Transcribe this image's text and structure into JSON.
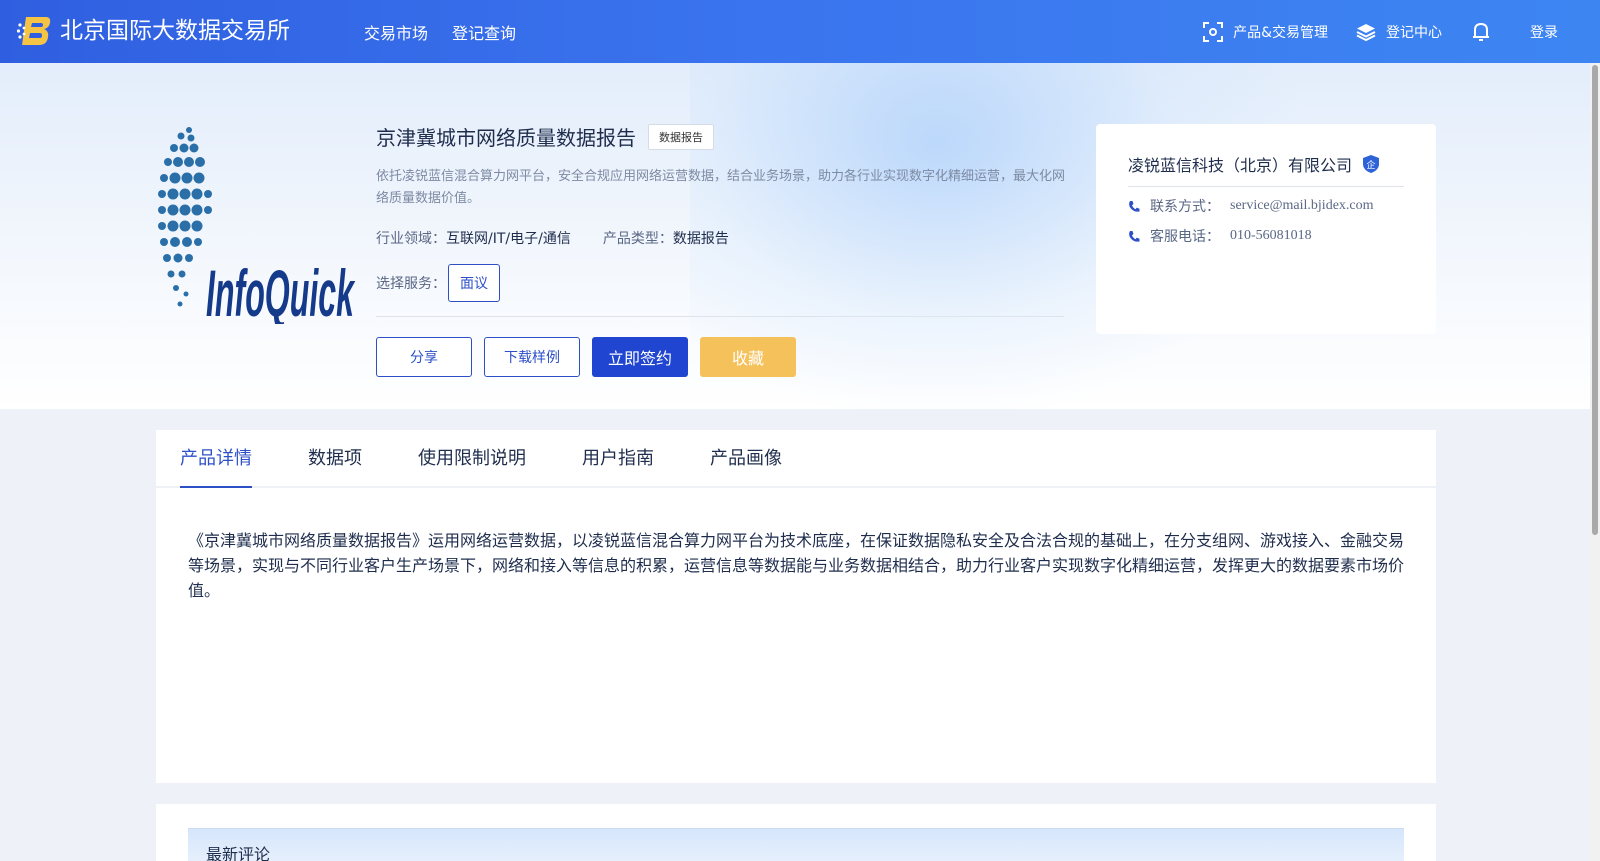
{
  "header": {
    "brand_name": "北京国际大数据交易所",
    "nav": [
      "交易市场",
      "登记查询"
    ],
    "product_mgmt": "产品&交易管理",
    "registry_center": "登记中心",
    "login": "登录"
  },
  "product": {
    "logo_text": "InfoQuick",
    "title": "京津冀城市网络质量数据报告",
    "tag": "数据报告",
    "description": "依托凌锐蓝信混合算力网平台，安全合规应用网络运营数据，结合业务场景，助力各行业实现数字化精细运营，最大化网络质量数据价值。",
    "industry_label": "行业领域：",
    "industry_value": "互联网/IT/电子/通信",
    "type_label": "产品类型：",
    "type_value": "数据报告",
    "service_label": "选择服务：",
    "service_option": "面议",
    "buttons": {
      "share": "分享",
      "download_sample": "下载样例",
      "sign_now": "立即签约",
      "favorite": "收藏"
    }
  },
  "company": {
    "name": "凌锐蓝信科技（北京）有限公司",
    "badge": "企",
    "contact_label": "联系方式：",
    "contact_value": "service@mail.bjidex.com",
    "phone_label": "客服电话：",
    "phone_value": "010-56081018"
  },
  "tabs": [
    "产品详情",
    "数据项",
    "使用限制说明",
    "用户指南",
    "产品画像"
  ],
  "active_tab": 0,
  "detail_text": "《京津冀城市网络质量数据报告》运用网络运营数据，以凌锐蓝信混合算力网平台为技术底座，在保证数据隐私安全及合法合规的基础上，在分支组网、游戏接入、金融交易等场景，实现与不同行业客户生产场景下，网络和接入等信息的积累，运营信息等数据能与业务数据相结合，助力行业客户实现数字化精细运营，发挥更大的数据要素市场价值。",
  "comments": {
    "title": "最新评论"
  },
  "colors": {
    "primary": "#1f45d1",
    "accent_gold": "#f4c15a",
    "header_gradient_start": "#2f5fe0",
    "header_gradient_end": "#3d86f2"
  }
}
